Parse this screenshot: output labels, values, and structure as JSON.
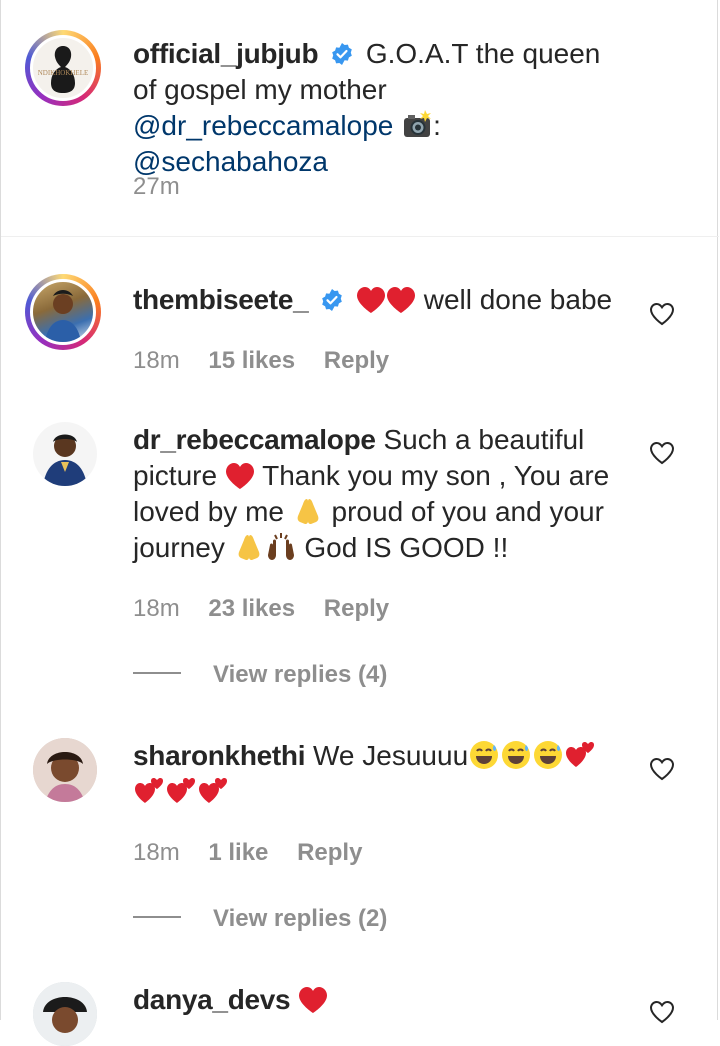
{
  "caption": {
    "username": "official_jubjub",
    "text_before": "G.O.A.T the queen of gospel my mother",
    "mention1": "@dr_rebeccamalope",
    "text_after": ":",
    "mention2": "@sechabahoza",
    "time": "27m",
    "avatar_text": "NDIKHOKHELE"
  },
  "comments": [
    {
      "username": "thembiseete_",
      "text": "well done babe",
      "time": "18m",
      "likes": "15 likes",
      "reply": "Reply"
    },
    {
      "username": "dr_rebeccamalope",
      "text1": "Such a beautiful picture",
      "text2": "Thank you my son , You are loved by me",
      "text3": "proud of you and your journey",
      "text4": "God IS GOOD !!",
      "time": "18m",
      "likes": "23 likes",
      "reply": "Reply",
      "view_replies": "View replies (4)"
    },
    {
      "username": "sharonkhethi",
      "text": "We Jesuuuu",
      "time": "18m",
      "likes": "1 like",
      "reply": "Reply",
      "view_replies": "View replies (2)"
    },
    {
      "username": "danya_devs"
    }
  ],
  "colors": {
    "text": "#262626",
    "meta": "#8e8e8e",
    "mention": "#00376b",
    "verified": "#3897f0",
    "heart": "#ed4956"
  }
}
